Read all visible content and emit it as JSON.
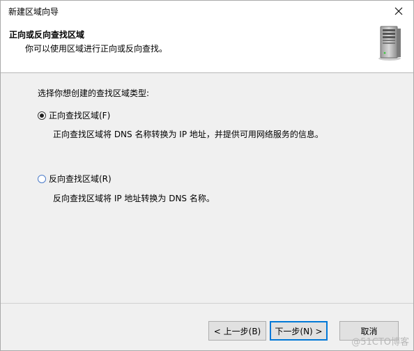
{
  "window": {
    "title": "新建区域向导"
  },
  "header": {
    "title": "正向或反向查找区域",
    "subtitle": "你可以使用区域进行正向或反向查找。"
  },
  "content": {
    "prompt": "选择你想创建的查找区域类型:",
    "options": [
      {
        "label": "正向查找区域(F)",
        "description": "正向查找区域将 DNS 名称转换为 IP 地址，并提供可用网络服务的信息。",
        "selected": true
      },
      {
        "label": "反向查找区域(R)",
        "description": "反向查找区域将 IP 地址转换为 DNS 名称。",
        "selected": false
      }
    ]
  },
  "buttons": {
    "back": "< 上一步(B)",
    "next": "下一步(N) >",
    "cancel": "取消"
  },
  "watermark": "@51CTO博客",
  "icons": {
    "close": "close-icon",
    "server": "server-icon"
  },
  "colors": {
    "focus": "#0078d7",
    "radio_unchecked_border": "#4a7ac8"
  }
}
